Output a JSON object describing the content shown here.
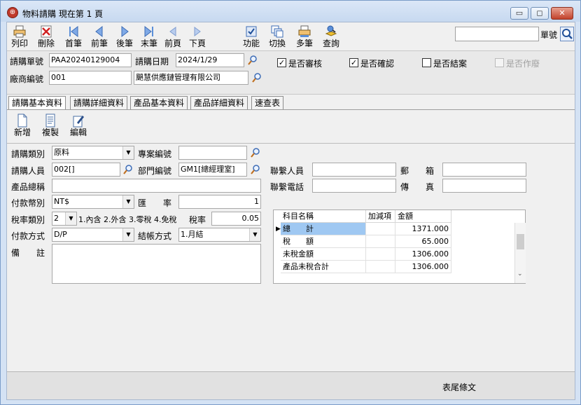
{
  "window": {
    "title": "物料請購 現在第 1 頁",
    "buttons": {
      "minimize": "▭",
      "maximize": "◻",
      "close": "✕"
    }
  },
  "toolbar": {
    "items": [
      {
        "id": "print",
        "label": "列印"
      },
      {
        "id": "delete",
        "label": "刪除"
      },
      {
        "id": "first",
        "label": "首筆"
      },
      {
        "id": "prev",
        "label": "前筆"
      },
      {
        "id": "next",
        "label": "後筆"
      },
      {
        "id": "last",
        "label": "末筆"
      },
      {
        "id": "prevpage",
        "label": "前頁"
      },
      {
        "id": "nextpage",
        "label": "下頁"
      },
      {
        "id": "function",
        "label": "功能"
      },
      {
        "id": "switch",
        "label": "切換"
      },
      {
        "id": "multi",
        "label": "多筆"
      },
      {
        "id": "query",
        "label": "查詢"
      }
    ],
    "search": {
      "value": "",
      "label": "單號"
    }
  },
  "header": {
    "req_no_label": "請購單號",
    "req_no": "PAA20240129004",
    "req_date_label": "請購日期",
    "req_date": "2024/1/29",
    "vendor_label": "廠商編號",
    "vendor_code": "001",
    "vendor_name": "颶慧供應鏈管理有限公司",
    "checks": [
      {
        "label": "是否審核",
        "checked": true,
        "disabled": false
      },
      {
        "label": "是否確認",
        "checked": true,
        "disabled": false
      },
      {
        "label": "是否結案",
        "checked": false,
        "disabled": false
      },
      {
        "label": "是否作廢",
        "checked": false,
        "disabled": true
      }
    ]
  },
  "tabs": [
    "請購基本資料",
    "請購詳細資料",
    "產品基本資料",
    "產品詳細資料",
    "速查表"
  ],
  "subtoolbar": [
    "新增",
    "複製",
    "編輯"
  ],
  "form": {
    "category_label": "請購類別",
    "category": "原料",
    "project_label": "專案編號",
    "project": "",
    "requester_label": "請購人員",
    "requester": "002[]",
    "dept_label": "部門編號",
    "dept": "GM1[總經理室]",
    "contact_label": "聯繫人員",
    "contact": "",
    "mail_label": "郵　　箱",
    "mail": "",
    "product_total_label": "產品總稱",
    "product_total": "",
    "phone_label": "聯繫電話",
    "phone": "",
    "fax_label": "傳　　真",
    "fax": "",
    "currency_label": "付款幣別",
    "currency": "NT$",
    "rate_label": "匯　　率",
    "rate": "1",
    "tax_type_label": "稅率類別",
    "tax_type": "2",
    "tax_type_hint": "1.內含 2.外含 3.零稅 4.免稅",
    "tax_rate_label": "稅率",
    "tax_rate": "0.05",
    "pay_method_label": "付款方式",
    "pay_method": "D/P",
    "settle_label": "結帳方式",
    "settle": "1.月結",
    "remark_label": "備　　註",
    "remark": ""
  },
  "summary": {
    "columns": [
      "科目名稱",
      "加減項",
      "金額"
    ],
    "rows": [
      {
        "name": "總　　計",
        "sign": "",
        "amount": "1371.000"
      },
      {
        "name": "稅　　額",
        "sign": "",
        "amount": "65.000"
      },
      {
        "name": "未稅金額",
        "sign": "",
        "amount": "1306.000"
      },
      {
        "name": "產品未稅合計",
        "sign": "",
        "amount": "1306.000"
      }
    ]
  },
  "footer": {
    "text": "表尾條文"
  }
}
